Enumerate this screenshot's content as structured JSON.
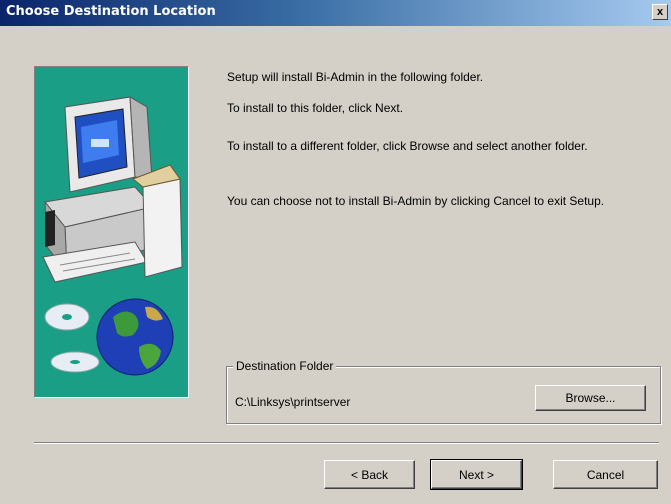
{
  "window": {
    "title": "Choose Destination Location",
    "close_label": "x"
  },
  "content": {
    "line1": "Setup will install Bi-Admin in the following folder.",
    "line2": "To install to this folder, click Next.",
    "line3": "To install to a different folder, click Browse and select another folder.",
    "line4": "You can choose not to install Bi-Admin by clicking Cancel to exit Setup."
  },
  "destination": {
    "group_label": "Destination Folder",
    "path": "C:\\Linksys\\printserver",
    "browse_label": "Browse..."
  },
  "buttons": {
    "back_label": "< Back",
    "next_label": "Next >",
    "cancel_label": "Cancel"
  },
  "colors": {
    "title_bar": "#0a246a",
    "art_background": "#1a9e86",
    "dialog_face": "#d4d0c8"
  },
  "icons": {
    "art": "computer-with-box-and-globe-cds"
  }
}
